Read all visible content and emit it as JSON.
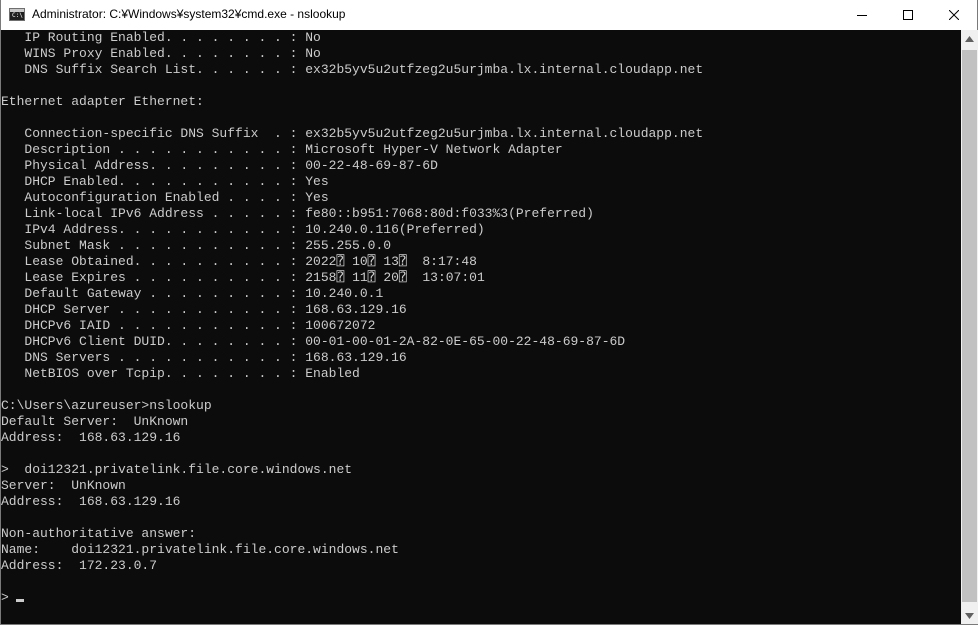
{
  "window": {
    "title": "Administrator: C:¥Windows¥system32¥cmd.exe - nslookup",
    "icon_text": "C:\\",
    "buttons": {
      "minimize": "minimize-icon",
      "maximize": "maximize-icon",
      "close": "close-icon"
    }
  },
  "console": {
    "lines": [
      "   IP Routing Enabled. . . . . . . . : No",
      "   WINS Proxy Enabled. . . . . . . . : No",
      "   DNS Suffix Search List. . . . . . : ex32b5yv5u2utfzeg2u5urjmba.lx.internal.cloudapp.net",
      "",
      "Ethernet adapter Ethernet:",
      "",
      "   Connection-specific DNS Suffix  . : ex32b5yv5u2utfzeg2u5urjmba.lx.internal.cloudapp.net",
      "   Description . . . . . . . . . . . : Microsoft Hyper-V Network Adapter",
      "   Physical Address. . . . . . . . . : 00-22-48-69-87-6D",
      "   DHCP Enabled. . . . . . . . . . . : Yes",
      "   Autoconfiguration Enabled . . . . : Yes",
      "   Link-local IPv6 Address . . . . . : fe80::b951:7068:80d:f033%3(Preferred)",
      "   IPv4 Address. . . . . . . . . . . : 10.240.0.116(Preferred)",
      "   Subnet Mask . . . . . . . . . . . : 255.255.0.0",
      "   Lease Obtained. . . . . . . . . . : 2022⍰ 10⍰ 13⍰  8:17:48",
      "   Lease Expires . . . . . . . . . . : 2158⍰ 11⍰ 20⍰  13:07:01",
      "   Default Gateway . . . . . . . . . : 10.240.0.1",
      "   DHCP Server . . . . . . . . . . . : 168.63.129.16",
      "   DHCPv6 IAID . . . . . . . . . . . : 100672072",
      "   DHCPv6 Client DUID. . . . . . . . : 00-01-00-01-2A-82-0E-65-00-22-48-69-87-6D",
      "   DNS Servers . . . . . . . . . . . : 168.63.129.16",
      "   NetBIOS over Tcpip. . . . . . . . : Enabled",
      "",
      "C:\\Users\\azureuser>nslookup",
      "Default Server:  UnKnown",
      "Address:  168.63.129.16",
      "",
      ">  doi12321.privatelink.file.core.windows.net",
      "Server:  UnKnown",
      "Address:  168.63.129.16",
      "",
      "Non-authoritative answer:",
      "Name:    doi12321.privatelink.file.core.windows.net",
      "Address:  172.23.0.7",
      "",
      ">"
    ]
  },
  "colors": {
    "console_bg": "#0c0c0c",
    "console_fg": "#cccccc",
    "titlebar_bg": "#ffffff"
  }
}
